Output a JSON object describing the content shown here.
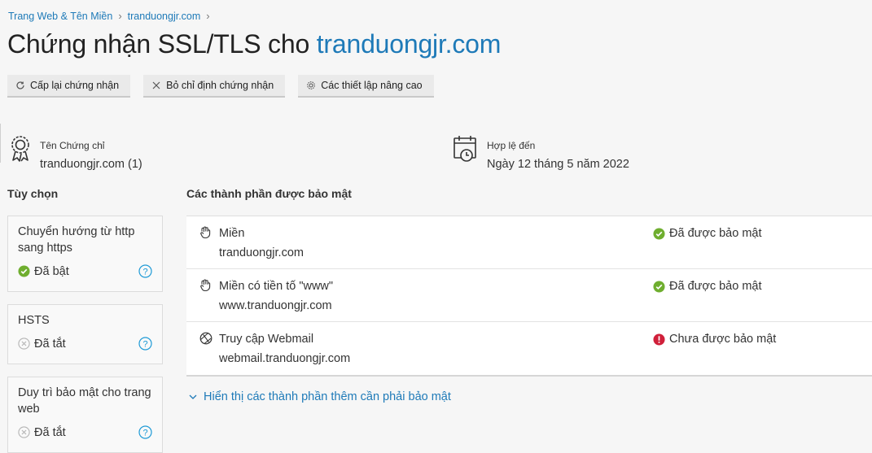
{
  "breadcrumb": {
    "item1": "Trang Web & Tên Miền",
    "item2": "tranduongjr.com",
    "separator": "›"
  },
  "title": {
    "prefix": "Chứng nhận SSL/TLS cho ",
    "domain": "tranduongjr.com"
  },
  "toolbar": {
    "reissue_label": "Cấp lại chứng nhận",
    "unassign_label": "Bỏ chỉ định chứng nhận",
    "advanced_label": "Các thiết lập nâng cao"
  },
  "certificate": {
    "name_label": "Tên Chứng chỉ",
    "name_value": "tranduongjr.com (1)",
    "valid_label": "Hợp lệ đến",
    "valid_value": "Ngày 12 tháng 5 năm 2022"
  },
  "options": {
    "title": "Tùy chọn",
    "items": [
      {
        "title": "Chuyển hướng từ http sang https",
        "status": "Đã bật",
        "state": "on"
      },
      {
        "title": "HSTS",
        "status": "Đã tắt",
        "state": "off"
      },
      {
        "title": "Duy trì bảo mật cho trang web",
        "status": "Đã tắt",
        "state": "off"
      }
    ]
  },
  "secured": {
    "title": "Các thành phần được bảo mật",
    "rows": [
      {
        "icon": "domain-icon",
        "name": "Miền",
        "domain": "tranduongjr.com",
        "status": "Đã được bảo mật",
        "state": "secured"
      },
      {
        "icon": "domain-icon",
        "name": "Miền có tiền tố \"www\"",
        "domain": "www.tranduongjr.com",
        "status": "Đã được bảo mật",
        "state": "secured"
      },
      {
        "icon": "webmail-icon",
        "name": "Truy cập Webmail",
        "domain": "webmail.tranduongjr.com",
        "status": "Chưa được bảo mật",
        "state": "unsecured"
      }
    ],
    "show_more": "Hiển thị các thành phần thêm cần phải bảo mật"
  },
  "colors": {
    "accent": "#1e7ab8",
    "success": "#6fae2f",
    "danger": "#d0203a",
    "muted": "#b5b5b5"
  }
}
